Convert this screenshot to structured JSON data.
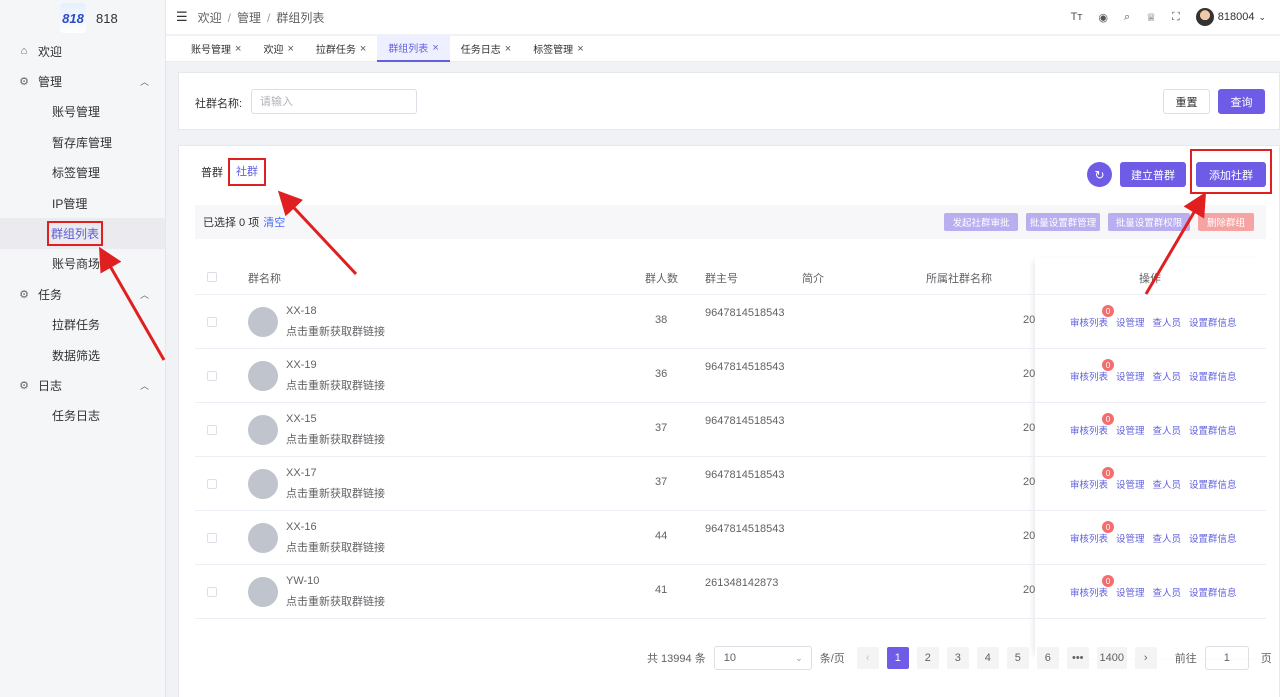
{
  "app": {
    "logo_mark": "818",
    "name": "818"
  },
  "sidebar": {
    "items": [
      {
        "type": "top",
        "label": "欢迎",
        "icon": "home-icon",
        "glyph": "⌂"
      },
      {
        "type": "top",
        "label": "管理",
        "icon": "gear-icon",
        "glyph": "⚙",
        "expanded": true
      },
      {
        "type": "sub",
        "label": "账号管理"
      },
      {
        "type": "sub",
        "label": "暂存库管理"
      },
      {
        "type": "sub",
        "label": "标签管理"
      },
      {
        "type": "sub",
        "label": "IP管理"
      },
      {
        "type": "sub",
        "label": "群组列表",
        "active": true
      },
      {
        "type": "sub",
        "label": "账号商场"
      },
      {
        "type": "top",
        "label": "任务",
        "icon": "gear-icon",
        "glyph": "⚙",
        "expanded": true
      },
      {
        "type": "sub",
        "label": "拉群任务"
      },
      {
        "type": "sub",
        "label": "数据筛选"
      },
      {
        "type": "top",
        "label": "日志",
        "icon": "gear-icon",
        "glyph": "⚙",
        "expanded": true
      },
      {
        "type": "sub",
        "label": "任务日志"
      }
    ]
  },
  "header": {
    "breadcrumb": [
      "欢迎",
      "管理",
      "群组列表"
    ],
    "user": "818004",
    "icons": [
      "font-size-icon",
      "github-icon",
      "search-icon",
      "theme-icon",
      "fullscreen-icon"
    ]
  },
  "tabs": [
    {
      "label": "账号管理"
    },
    {
      "label": "欢迎"
    },
    {
      "label": "拉群任务"
    },
    {
      "label": "群组列表",
      "active": true
    },
    {
      "label": "任务日志"
    },
    {
      "label": "标签管理"
    }
  ],
  "search": {
    "label": "社群名称:",
    "placeholder": "请输入",
    "reset": "重置",
    "query": "查询"
  },
  "main": {
    "type_tabs": [
      "普群",
      "社群"
    ],
    "buttons": {
      "build": "建立普群",
      "add": "添加社群"
    },
    "selection": {
      "prefix": "已选择 0 项",
      "clear": "清空"
    },
    "bulk": [
      "发起社群审批",
      "批量设置群管理",
      "批量设置群权限",
      "删除群组"
    ]
  },
  "table": {
    "columns": [
      "群名称",
      "群人数",
      "群主号",
      "简介",
      "所属社群名称",
      "操作"
    ],
    "rows": [
      {
        "name": "XX-18",
        "sub": "点击重新获取群链接",
        "count": "38",
        "owner": "9647814518543",
        "trunc": "20",
        "badge": "0"
      },
      {
        "name": "XX-19",
        "sub": "点击重新获取群链接",
        "count": "36",
        "owner": "9647814518543",
        "trunc": "20",
        "badge": "0"
      },
      {
        "name": "XX-15",
        "sub": "点击重新获取群链接",
        "count": "37",
        "owner": "9647814518543",
        "trunc": "20",
        "badge": "0"
      },
      {
        "name": "XX-17",
        "sub": "点击重新获取群链接",
        "count": "37",
        "owner": "9647814518543",
        "trunc": "20",
        "badge": "0"
      },
      {
        "name": "XX-16",
        "sub": "点击重新获取群链接",
        "count": "44",
        "owner": "9647814518543",
        "trunc": "20",
        "badge": "0"
      },
      {
        "name": "YW-10",
        "sub": "点击重新获取群链接",
        "count": "41",
        "owner": "261348142873",
        "trunc": "20",
        "badge": "0"
      }
    ],
    "ops": [
      "审核列表",
      "设管理",
      "查人员",
      "设置群信息"
    ]
  },
  "pager": {
    "total": "共 13994 条",
    "size": "10",
    "per": "条/页",
    "pages": [
      "1",
      "2",
      "3",
      "4",
      "5",
      "6",
      "•••",
      "1400"
    ],
    "goto_prefix": "前往",
    "goto_value": "1",
    "goto_suffix": "页"
  },
  "colors": {
    "accent": "#6f5ce6",
    "annotation": "#e02020"
  }
}
